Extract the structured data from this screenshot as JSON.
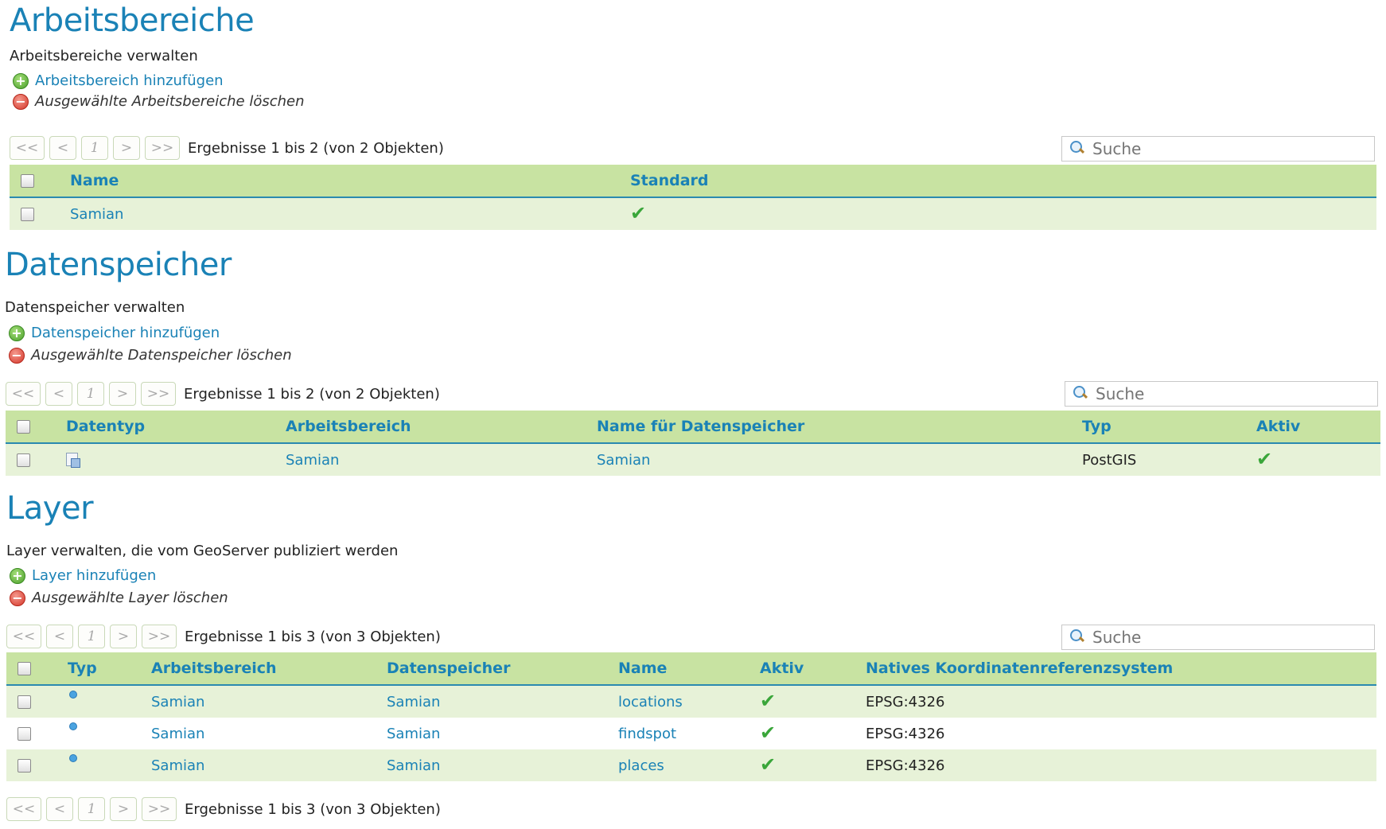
{
  "workspaces": {
    "title": "Arbeitsbereiche",
    "description": "Arbeitsbereiche verwalten",
    "add_label": "Arbeitsbereich hinzufügen",
    "delete_label": "Ausgewählte Arbeitsbereiche löschen",
    "pager": {
      "first": "<<",
      "prev": "<",
      "page": "1",
      "next": ">",
      "last": ">>",
      "results": "Ergebnisse 1 bis 2 (von 2 Objekten)"
    },
    "search_placeholder": "Suche",
    "columns": [
      "Name",
      "Standard"
    ],
    "rows": [
      {
        "name": "Samian",
        "standard": "✔"
      }
    ]
  },
  "stores": {
    "title": "Datenspeicher",
    "description": "Datenspeicher verwalten",
    "add_label": "Datenspeicher hinzufügen",
    "delete_label": "Ausgewählte Datenspeicher löschen",
    "pager": {
      "first": "<<",
      "prev": "<",
      "page": "1",
      "next": ">",
      "last": ">>",
      "results": "Ergebnisse 1 bis 2 (von 2 Objekten)"
    },
    "search_placeholder": "Suche",
    "columns": [
      "Datentyp",
      "Arbeitsbereich",
      "Name für Datenspeicher",
      "Typ",
      "Aktiv"
    ],
    "rows": [
      {
        "datatype_icon": "store-icon",
        "workspace": "Samian",
        "name": "Samian",
        "type": "PostGIS",
        "active": "✔"
      }
    ]
  },
  "layers": {
    "title": "Layer",
    "description": "Layer verwalten, die vom GeoServer publiziert werden",
    "add_label": "Layer hinzufügen",
    "delete_label": "Ausgewählte Layer löschen",
    "pager": {
      "first": "<<",
      "prev": "<",
      "page": "1",
      "next": ">",
      "last": ">>",
      "results": "Ergebnisse 1 bis 3 (von 3 Objekten)"
    },
    "search_placeholder": "Suche",
    "columns": [
      "Typ",
      "Arbeitsbereich",
      "Datenspeicher",
      "Name",
      "Aktiv",
      "Natives Koordinatenreferenzsystem"
    ],
    "rows": [
      {
        "type_icon": "point-icon",
        "workspace": "Samian",
        "store": "Samian",
        "name": "locations",
        "active": "✔",
        "crs": "EPSG:4326"
      },
      {
        "type_icon": "point-icon",
        "workspace": "Samian",
        "store": "Samian",
        "name": "findspot",
        "active": "✔",
        "crs": "EPSG:4326"
      },
      {
        "type_icon": "point-icon",
        "workspace": "Samian",
        "store": "Samian",
        "name": "places",
        "active": "✔",
        "crs": "EPSG:4326"
      }
    ]
  },
  "colors": {
    "accent": "#1a82b6",
    "header_bg": "#c8e3a2",
    "row_even": "#e7f2d8",
    "check": "#3aa63a"
  }
}
